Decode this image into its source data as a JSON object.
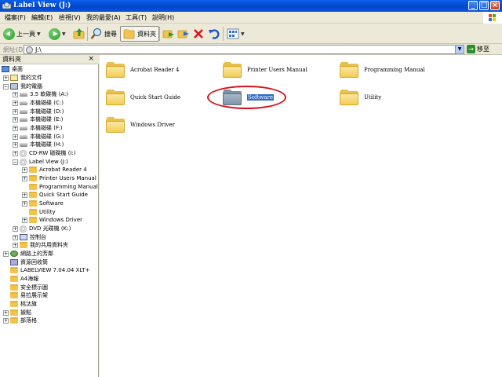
{
  "window": {
    "title": "Label View (J:)"
  },
  "menu": [
    "檔案(F)",
    "編輯(E)",
    "檢視(V)",
    "我的最愛(A)",
    "工具(T)",
    "說明(H)"
  ],
  "toolbar": {
    "back_label": "上一頁",
    "search_label": "搜尋",
    "folders_label": "資料夾"
  },
  "address": {
    "label": "網址(D)",
    "value": "J:\\",
    "go_label": "移至"
  },
  "folder_pane": {
    "title": "資料夾",
    "close": "×",
    "tree": [
      {
        "label": "桌面",
        "icon": "desktop-icon"
      },
      {
        "label": "我的文件",
        "icon": "documents-icon"
      },
      {
        "label": "我的電腦",
        "icon": "computer-icon"
      },
      {
        "label": "3.5 軟碟機 (A:)",
        "icon": "floppy-icon"
      },
      {
        "label": "本機磁碟 (C:)",
        "icon": "drive-icon"
      },
      {
        "label": "本機磁碟 (D:)",
        "icon": "drive-icon"
      },
      {
        "label": "本機磁碟 (E:)",
        "icon": "drive-icon"
      },
      {
        "label": "本機磁碟 (F:)",
        "icon": "drive-icon"
      },
      {
        "label": "本機磁碟 (G:)",
        "icon": "drive-icon"
      },
      {
        "label": "本機磁碟 (H:)",
        "icon": "drive-icon"
      },
      {
        "label": "CD-RW 磁碟機 (I:)",
        "icon": "cd-icon"
      },
      {
        "label": "Label View (J:)",
        "icon": "cd-icon"
      },
      {
        "label": "Acrobat Reader 4",
        "icon": "folder-icon"
      },
      {
        "label": "Printer Users Manual",
        "icon": "folder-icon"
      },
      {
        "label": "Programming Manual",
        "icon": "folder-icon"
      },
      {
        "label": "Quick Start Guide",
        "icon": "folder-icon"
      },
      {
        "label": "Software",
        "icon": "folder-icon"
      },
      {
        "label": "Utility",
        "icon": "folder-icon"
      },
      {
        "label": "Windows Driver",
        "icon": "folder-icon"
      },
      {
        "label": "DVD 光碟機 (K:)",
        "icon": "cd-icon"
      },
      {
        "label": "控制台",
        "icon": "control-panel-icon"
      },
      {
        "label": "我的共用資料夾",
        "icon": "folder-icon"
      },
      {
        "label": "網路上的芳鄰",
        "icon": "network-icon"
      },
      {
        "label": "資源回收筒",
        "icon": "recycle-bin-icon"
      },
      {
        "label": "LABELVIEW 7.04.04 XLT+",
        "icon": "folder-icon"
      },
      {
        "label": "A4海報",
        "icon": "folder-icon"
      },
      {
        "label": "安全標示圖",
        "icon": "folder-icon"
      },
      {
        "label": "易拉展示架",
        "icon": "folder-icon"
      },
      {
        "label": "桃汰旗",
        "icon": "folder-icon"
      },
      {
        "label": "據點",
        "icon": "folder-icon"
      },
      {
        "label": "部落格",
        "icon": "folder-icon"
      }
    ]
  },
  "content": {
    "items": [
      {
        "label": "Acrobat Reader 4",
        "selected": false
      },
      {
        "label": "Printer Users Manual",
        "selected": false
      },
      {
        "label": "Programming Manual",
        "selected": false
      },
      {
        "label": "Quick Start Guide",
        "selected": false
      },
      {
        "label": "Software",
        "selected": true
      },
      {
        "label": "Utility",
        "selected": false
      },
      {
        "label": "Windows Driver",
        "selected": false
      }
    ]
  },
  "colors": {
    "titlebar": "#0246c9",
    "highlight_ring": "#d6131c",
    "selection": "#316ac5"
  }
}
